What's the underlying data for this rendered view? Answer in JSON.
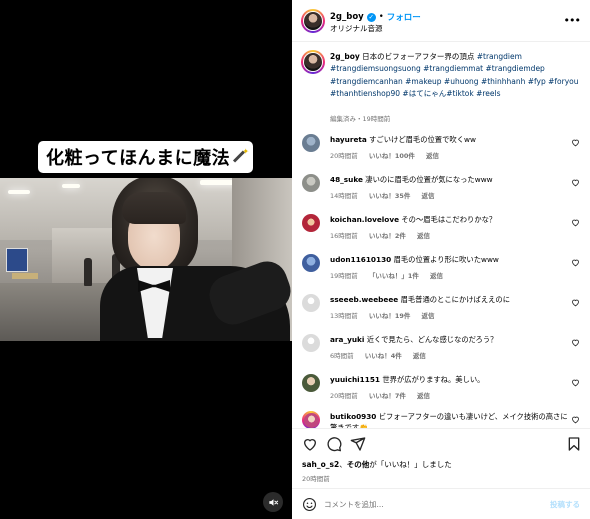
{
  "video": {
    "caption": "化粧ってほんまに魔法"
  },
  "header": {
    "username": "2g_boy",
    "separator": "•",
    "follow_label": "フォロー",
    "audio_label": "オリジナル音源",
    "more_icon": "more-horizontal-icon"
  },
  "post": {
    "username": "2g_boy",
    "text": "日本のビフォーアフター界の頂点",
    "hashtags": "#trangdiem #trangdiemsuongsuong #trangdiemmat #trangdiemdep #trangdiemcanhan #makeup #uhuong #thinhhanh #fyp #foryou #thanhtienshop90 #はてにゃん#tiktok #reels",
    "meta": "編集済み・19時間前"
  },
  "comments": [
    {
      "user": "hayureta",
      "text": "すごいけど眉毛の位置で吹くww",
      "time": "20時間前",
      "likes": "いいね！100件",
      "reply": "返信",
      "avatar_color": "#6a7d92"
    },
    {
      "user": "48_suke",
      "text": "凄いのに眉毛の位置が気になったwww",
      "time": "14時間前",
      "likes": "いいね！35件",
      "reply": "返信",
      "avatar_color": "#8d8f8a"
    },
    {
      "user": "koichan.lovelove",
      "text": "その～眉毛はこだわりかな？",
      "time": "16時間前",
      "likes": "いいね！2件",
      "reply": "返信",
      "avatar_color": "#b3263a"
    },
    {
      "user": "udon11610130",
      "text": "眉毛の位置より形に吹いたwww",
      "time": "19時間前",
      "likes": "「いいね！」1件",
      "reply": "返信",
      "avatar_color": "#3f5f9e"
    },
    {
      "user": "sseeeb.weebeee",
      "text": "眉毛普通のとこにかけばええのに",
      "time": "13時間前",
      "likes": "いいね！19件",
      "reply": "返信",
      "avatar_color": "#dbdbdb"
    },
    {
      "user": "ara_yuki",
      "text": "近くで見たら、どんな感じなのだろう？",
      "time": "6時間前",
      "likes": "いいね！4件",
      "reply": "返信",
      "avatar_color": "#dbdbdb"
    },
    {
      "user": "yuuichi1151",
      "text": "世界が広がりますね。美しい。",
      "time": "20時間前",
      "likes": "いいね！7件",
      "reply": "返信",
      "avatar_color": "#4a5a3a"
    },
    {
      "user": "butiko0930",
      "text": "ビフォーアフターの違いも凄いけど、メイク技術の高さに驚きです👏",
      "time": "",
      "likes": "",
      "reply": "",
      "avatar_color": "#c0477e"
    }
  ],
  "actions": {
    "like_icon": "heart-icon",
    "comment_icon": "comment-icon",
    "share_icon": "send-icon",
    "save_icon": "bookmark-icon"
  },
  "likes_line": {
    "users": "sah_o_s2",
    "connector": "、",
    "others": "その他",
    "suffix": "が「いいね！」しました"
  },
  "post_time": "20時間前",
  "comment_box": {
    "placeholder": "コメントを追加...",
    "post_label": "投稿する"
  },
  "colors": {
    "accent": "#0095f6",
    "link": "#00376b",
    "muted": "#737373",
    "post_disabled": "#b2dffc"
  }
}
